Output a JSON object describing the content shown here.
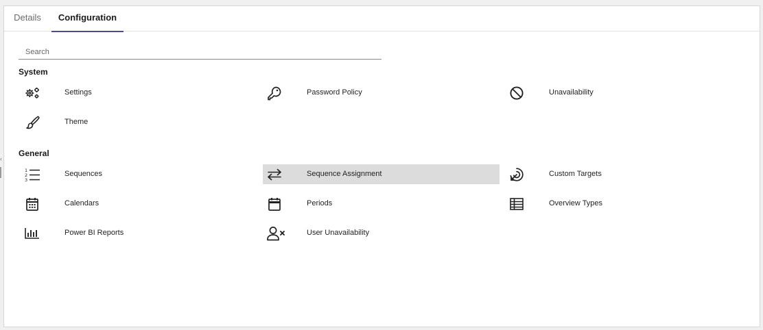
{
  "tabs": [
    {
      "label": "Details",
      "active": false
    },
    {
      "label": "Configuration",
      "active": true
    }
  ],
  "search": {
    "placeholder": "Search",
    "value": ""
  },
  "sections": {
    "system": {
      "title": "System",
      "items": [
        {
          "label": "Settings",
          "icon": "gears-icon"
        },
        {
          "label": "Password Policy",
          "icon": "key-icon"
        },
        {
          "label": "Unavailability",
          "icon": "block-icon"
        },
        {
          "label": "Theme",
          "icon": "brush-icon"
        }
      ]
    },
    "general": {
      "title": "General",
      "items": [
        {
          "label": "Sequences",
          "icon": "numbered-list-icon"
        },
        {
          "label": "Sequence Assignment",
          "icon": "swap-arrows-icon",
          "highlighted": true
        },
        {
          "label": "Custom Targets",
          "icon": "target-icon"
        },
        {
          "label": "Calendars",
          "icon": "calendar-grid-icon"
        },
        {
          "label": "Periods",
          "icon": "calendar-icon"
        },
        {
          "label": "Overview Types",
          "icon": "table-icon"
        },
        {
          "label": "Power BI Reports",
          "icon": "bar-chart-icon"
        },
        {
          "label": "User Unavailability",
          "icon": "user-remove-icon"
        }
      ]
    }
  },
  "colors": {
    "tab_underline": "#4a4a8c",
    "highlight": "#dcdcdc"
  }
}
